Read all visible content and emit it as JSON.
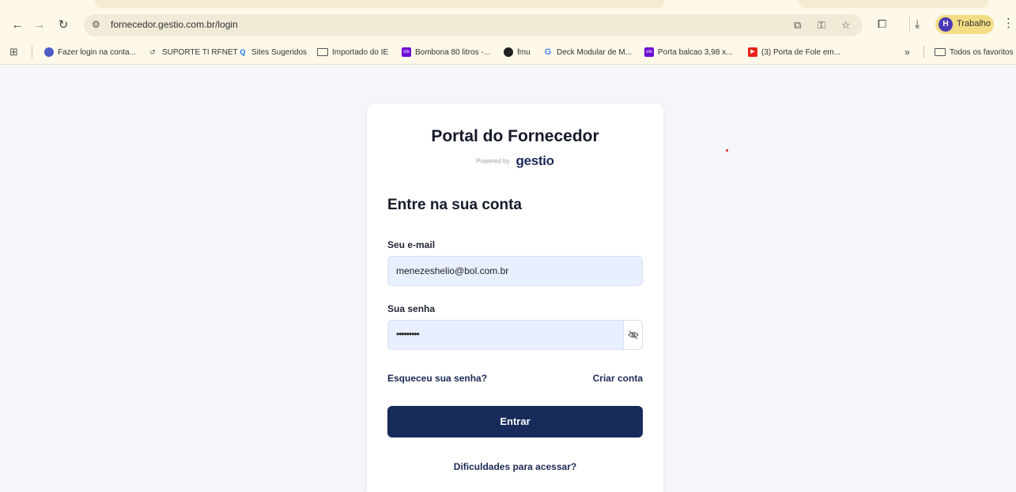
{
  "browser": {
    "url": "fornecedor.gestio.com.br/login",
    "profile": {
      "initial": "H",
      "label": "Trabalho"
    },
    "bookmarks": [
      {
        "label": "Fazer login na conta...",
        "icon": "teams-icon"
      },
      {
        "label": "SUPORTE TI RFNET",
        "icon": "link-icon"
      },
      {
        "label": "Sites Sugeridos",
        "icon": "search-icon"
      },
      {
        "label": "Importado do IE",
        "icon": "folder-icon"
      },
      {
        "label": "Bombona 80 litros -...",
        "icon": "olx-icon"
      },
      {
        "label": "fmu",
        "icon": "github-icon"
      },
      {
        "label": "Deck Modular de M...",
        "icon": "google-icon"
      },
      {
        "label": "Porta balcao 3,98 x...",
        "icon": "olx-icon"
      },
      {
        "label": "(3) Porta de Fole em...",
        "icon": "youtube-icon"
      }
    ],
    "overflow_label": "»",
    "all_bookmarks": "Todos os favoritos"
  },
  "login": {
    "title": "Portal do Fornecedor",
    "powered_by": "Powered by",
    "brand": "gestio",
    "subtitle": "Entre na sua conta",
    "email_label": "Seu e-mail",
    "email_value": "menezeshelio@bol.com.br",
    "password_label": "Sua senha",
    "password_value": "•••••••••",
    "forgot_link": "Esqueceu sua senha?",
    "create_link": "Criar conta",
    "submit": "Entrar",
    "help_link": "Dificuldades para acessar?"
  },
  "colors": {
    "primary": "#172b5b",
    "field_bg": "#e8effe",
    "chrome_bg": "#fdf8e8"
  }
}
